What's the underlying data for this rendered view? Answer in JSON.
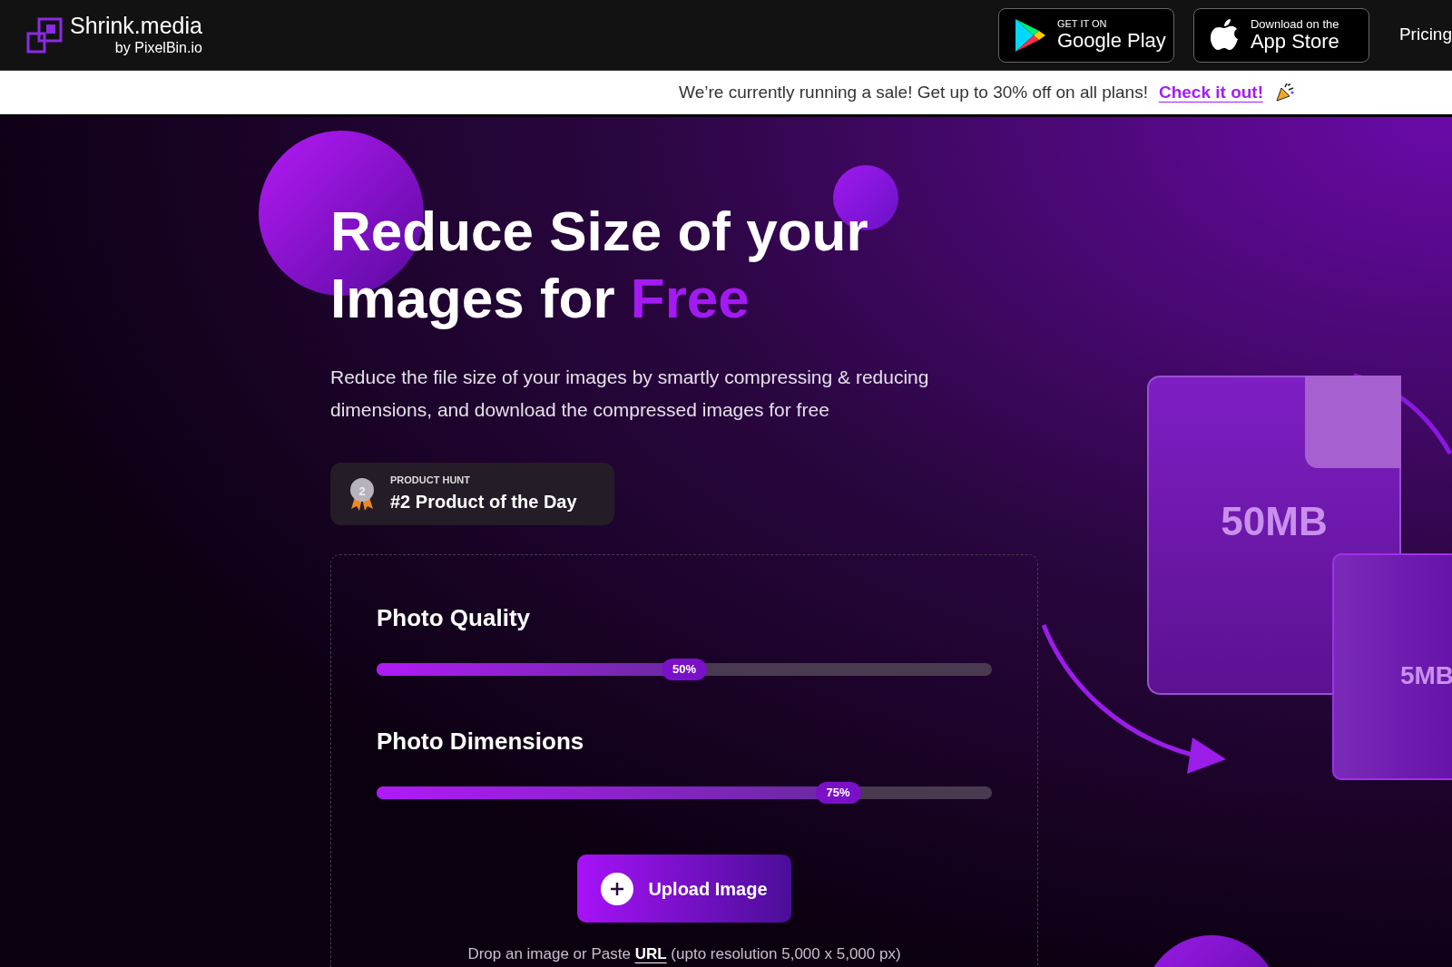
{
  "header": {
    "logo": {
      "name": "Shrink.media",
      "byline": "by PixelBin.io"
    },
    "store_buttons": [
      {
        "kind": "google",
        "small": "GET IT ON",
        "big": "Google Play"
      },
      {
        "kind": "apple",
        "small": "Download on the",
        "big": "App Store"
      }
    ],
    "nav": [
      "Pricing"
    ]
  },
  "banner": {
    "text": "We’re currently running a sale! Get up to 30% off on all plans!",
    "link": "Check it out!"
  },
  "hero": {
    "title": "Reduce Size of your Images for",
    "title_highlight": "Free",
    "subtitle": "Reduce the file size of your images by smartly compressing & reducing dimensions, and download the compressed images for free",
    "badge": {
      "rank": "2",
      "kicker": "PRODUCT HUNT",
      "text": "#2 Product of the Day"
    }
  },
  "uploader": {
    "sliders": [
      {
        "label": "Photo Quality",
        "level": 0.5,
        "reading": "50%"
      },
      {
        "label": "Photo Dimensions",
        "level": 0.75,
        "reading": "75%"
      }
    ],
    "button": "Upload Image",
    "hint": {
      "before": "Drop an image or Paste",
      "link": "URL",
      "after": "(upto resolution 5,000 x 5,000 px)"
    }
  },
  "illustration": {
    "big_file": "50MB",
    "small_file": "5MB"
  }
}
